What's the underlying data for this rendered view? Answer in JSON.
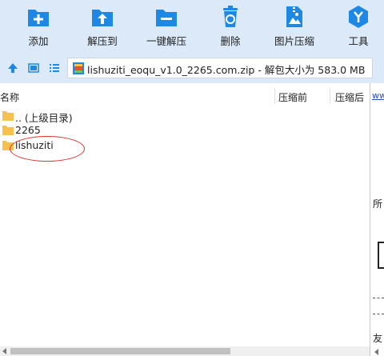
{
  "toolbar": {
    "add": "添加",
    "extract": "解压到",
    "one_click": "一键解压",
    "delete": "删除",
    "image_compress": "图片压缩",
    "tools": "工具"
  },
  "address": {
    "text": "lishuziti_eoqu_v1.0_2265.com.zip - 解包大小为 583.0 MB"
  },
  "columns": {
    "name": "名称",
    "compressed_before": "压缩前",
    "compressed_after": "压缩后"
  },
  "files": [
    {
      "name": ".. (上级目录)"
    },
    {
      "name": "2265"
    },
    {
      "name": "lishuziti"
    }
  ],
  "right_pane": {
    "link": "www",
    "text1": "所",
    "text2": "友"
  },
  "colors": {
    "accent": "#1e88e5",
    "toolbar_bg": "#dbe9f8",
    "folder": "#f6c24d",
    "annotation": "#d9342b"
  }
}
